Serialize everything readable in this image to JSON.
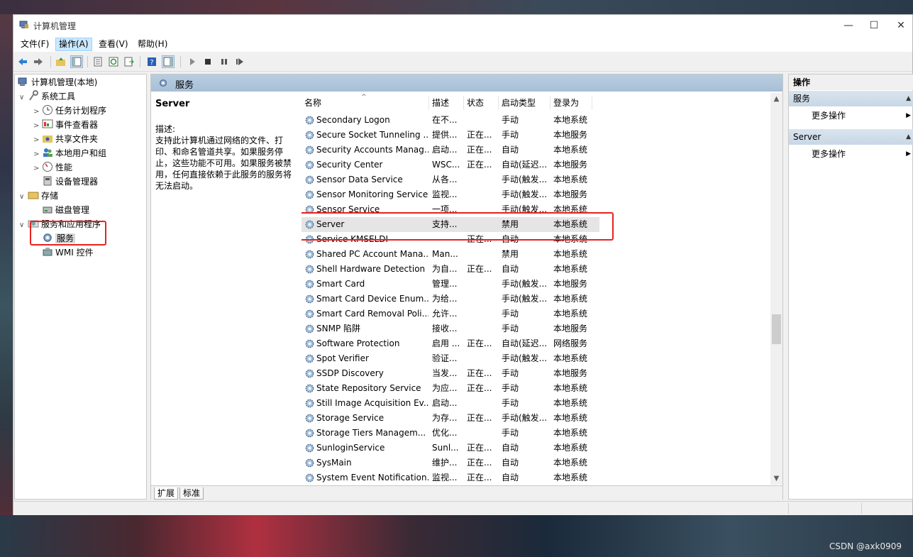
{
  "window": {
    "title": "计算机管理",
    "controls": [
      "—",
      "☐",
      "✕"
    ]
  },
  "menu": [
    "文件(F)",
    "操作(A)",
    "查看(V)",
    "帮助(H)"
  ],
  "tree": {
    "root": "计算机管理(本地)",
    "system_tools": "系统工具",
    "task_scheduler": "任务计划程序",
    "event_viewer": "事件查看器",
    "shared_folders": "共享文件夹",
    "local_users": "本地用户和组",
    "performance": "性能",
    "device_manager": "设备管理器",
    "storage": "存储",
    "disk_management": "磁盘管理",
    "services_apps": "服务和应用程序",
    "services": "服务",
    "wmi": "WMI 控件"
  },
  "center": {
    "title": "服务",
    "selected_service": "Server",
    "desc_label": "描述:",
    "description": "支持此计算机通过网络的文件、打印、和命名管道共享。如果服务停止，这些功能不可用。如果服务被禁用，任何直接依赖于此服务的服务将无法启动。",
    "columns": [
      "名称",
      "描述",
      "状态",
      "启动类型",
      "登录为"
    ],
    "tabs": [
      "扩展",
      "标准"
    ]
  },
  "services": [
    [
      "Secondary Logon",
      "在不...",
      "",
      "手动",
      "本地系统"
    ],
    [
      "Secure Socket Tunneling ...",
      "提供...",
      "正在...",
      "手动",
      "本地服务"
    ],
    [
      "Security Accounts Manag...",
      "启动...",
      "正在...",
      "自动",
      "本地系统"
    ],
    [
      "Security Center",
      "WSC...",
      "正在...",
      "自动(延迟...",
      "本地服务"
    ],
    [
      "Sensor Data Service",
      "从各...",
      "",
      "手动(触发...",
      "本地系统"
    ],
    [
      "Sensor Monitoring Service",
      "监视...",
      "",
      "手动(触发...",
      "本地服务"
    ],
    [
      "Sensor Service",
      "一项...",
      "",
      "手动(触发...",
      "本地系统"
    ],
    [
      "Server",
      "支持...",
      "",
      "禁用",
      "本地系统"
    ],
    [
      "Service KMSELDI",
      "",
      "正在...",
      "自动",
      "本地系统"
    ],
    [
      "Shared PC Account Mana...",
      "Man...",
      "",
      "禁用",
      "本地系统"
    ],
    [
      "Shell Hardware Detection",
      "为自...",
      "正在...",
      "自动",
      "本地系统"
    ],
    [
      "Smart Card",
      "管理...",
      "",
      "手动(触发...",
      "本地服务"
    ],
    [
      "Smart Card Device Enum...",
      "为给...",
      "",
      "手动(触发...",
      "本地系统"
    ],
    [
      "Smart Card Removal Poli...",
      "允许...",
      "",
      "手动",
      "本地系统"
    ],
    [
      "SNMP 陷阱",
      "接收...",
      "",
      "手动",
      "本地服务"
    ],
    [
      "Software Protection",
      "启用 ...",
      "正在...",
      "自动(延迟...",
      "网络服务"
    ],
    [
      "Spot Verifier",
      "验证...",
      "",
      "手动(触发...",
      "本地系统"
    ],
    [
      "SSDP Discovery",
      "当发...",
      "正在...",
      "手动",
      "本地服务"
    ],
    [
      "State Repository Service",
      "为应...",
      "正在...",
      "手动",
      "本地系统"
    ],
    [
      "Still Image Acquisition Ev...",
      "启动...",
      "",
      "手动",
      "本地系统"
    ],
    [
      "Storage Service",
      "为存...",
      "正在...",
      "手动(触发...",
      "本地系统"
    ],
    [
      "Storage Tiers Managem...",
      "优化...",
      "",
      "手动",
      "本地系统"
    ],
    [
      "SunloginService",
      "Sunl...",
      "正在...",
      "自动",
      "本地系统"
    ],
    [
      "SysMain",
      "维护...",
      "正在...",
      "自动",
      "本地系统"
    ],
    [
      "System Event Notification...",
      "监视...",
      "正在...",
      "自动",
      "本地系统"
    ]
  ],
  "actions": {
    "title": "操作",
    "section1": "服务",
    "section2": "Server",
    "more": "更多操作"
  },
  "watermark": "CSDN @axk0909",
  "colors": {
    "highlight": "#e5231f",
    "header": "#a7bfd6",
    "selected_row": "#e5e5e5"
  }
}
